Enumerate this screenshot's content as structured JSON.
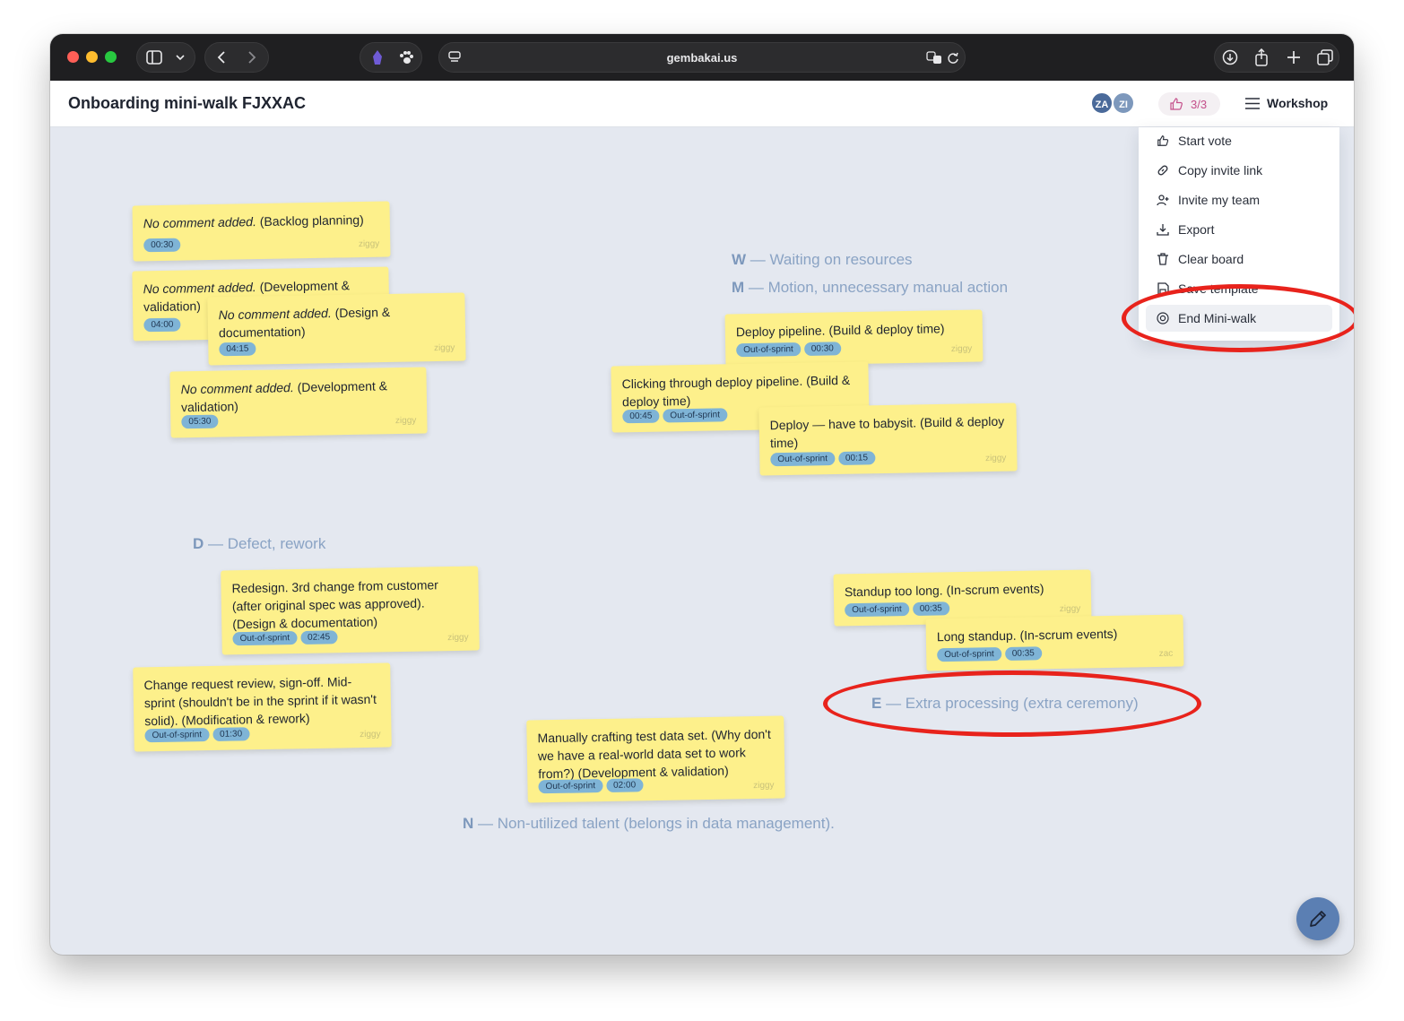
{
  "browser": {
    "url": "gembakai.us"
  },
  "header": {
    "title": "Onboarding mini-walk FJXXAC",
    "avatars": [
      {
        "initials": "ZA",
        "color": "#4a6a9a"
      },
      {
        "initials": "ZI",
        "color": "#7d98bc"
      }
    ],
    "votes": "3/3",
    "workshop_label": "Workshop"
  },
  "menu": {
    "items": [
      {
        "label": "Start vote",
        "icon": "thumbs-up-icon"
      },
      {
        "label": "Copy invite link",
        "icon": "link-icon"
      },
      {
        "label": "Invite my team",
        "icon": "user-plus-icon"
      },
      {
        "label": "Export",
        "icon": "download-icon"
      },
      {
        "label": "Clear board",
        "icon": "trash-icon"
      },
      {
        "label": "Save template",
        "icon": "save-icon"
      },
      {
        "label": "End Mini-walk",
        "icon": "stop-circle-icon"
      }
    ]
  },
  "categories": {
    "w": {
      "letter": "W",
      "text": "— Waiting on resources"
    },
    "m": {
      "letter": "M",
      "text": "— Motion, unnecessary manual action"
    },
    "d": {
      "letter": "D",
      "text": "— Defect, rework"
    },
    "e": {
      "letter": "E",
      "text": "— Extra processing (extra ceremony)"
    },
    "n": {
      "letter": "N",
      "text": "— Non-utilized talent (belongs in data management)."
    }
  },
  "notes": {
    "n1": {
      "em": "No comment added.",
      "text": " (Backlog planning)",
      "tags": [
        "00:30"
      ],
      "author": "ziggy"
    },
    "n2": {
      "em": "No comment added.",
      "text": " (Development & validation)",
      "tags": [
        "04:00"
      ],
      "author": ""
    },
    "n3": {
      "em": "No comment added.",
      "text": " (Design & documentation)",
      "tags": [
        "04:15"
      ],
      "author": "ziggy"
    },
    "n4": {
      "em": "No comment added.",
      "text": " (Development & validation)",
      "tags": [
        "05:30"
      ],
      "author": "ziggy"
    },
    "n5": {
      "text": "Deploy pipeline. (Build & deploy time)",
      "tags": [
        "Out-of-sprint",
        "00:30"
      ],
      "author": "ziggy"
    },
    "n6": {
      "text": "Clicking through deploy pipeline. (Build & deploy time)",
      "tags": [
        "00:45",
        "Out-of-sprint"
      ],
      "author": ""
    },
    "n7": {
      "text": "Deploy — have to babysit. (Build & deploy time)",
      "tags": [
        "Out-of-sprint",
        "00:15"
      ],
      "author": "ziggy"
    },
    "n8": {
      "text": "Redesign. 3rd change from customer (after original spec was approved). (Design & documentation)",
      "tags": [
        "Out-of-sprint",
        "02:45"
      ],
      "author": "ziggy"
    },
    "n9": {
      "text": "Change request review, sign-off. Mid-sprint (shouldn't be in the sprint if it wasn't solid). (Modification & rework)",
      "tags": [
        "Out-of-sprint",
        "01:30"
      ],
      "author": "ziggy"
    },
    "n10": {
      "text": "Standup too long. (In-scrum events)",
      "tags": [
        "Out-of-sprint",
        "00:35"
      ],
      "author": "ziggy"
    },
    "n11": {
      "text": "Long standup. (In-scrum events)",
      "tags": [
        "Out-of-sprint",
        "00:35"
      ],
      "author": "zac"
    },
    "n12": {
      "text": "Manually crafting test data set. (Why don't we have a real-world data set to work from?) (Development & validation)",
      "tags": [
        "Out-of-sprint",
        "02:00"
      ],
      "author": "ziggy"
    }
  },
  "colors": {
    "note": "#fdf08b",
    "tag": "#7fb4d6",
    "category": "#8aa3c4",
    "highlight_circle": "#e8231c",
    "fab": "#5b7fb3"
  }
}
